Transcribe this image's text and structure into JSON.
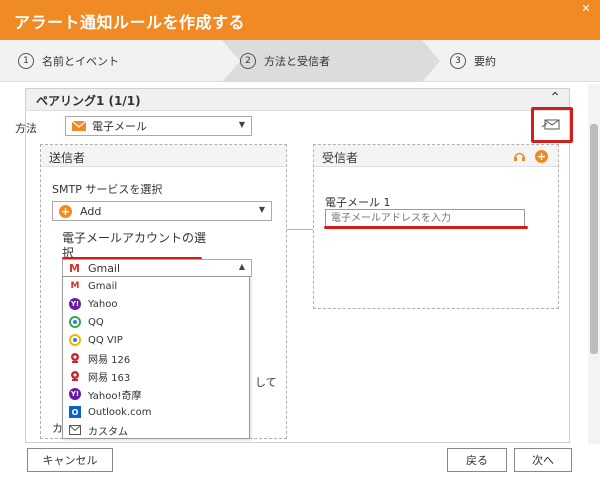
{
  "window": {
    "title": "アラート通知ルールを作成する",
    "close_glyph": "✕"
  },
  "steps": [
    {
      "num": "1",
      "label": "名前とイベント"
    },
    {
      "num": "2",
      "label": "方法と受信者"
    },
    {
      "num": "3",
      "label": "要約"
    }
  ],
  "pairing": {
    "title": "ペアリング1 (1/1)",
    "collapse_glyph": "⌃"
  },
  "method": {
    "label": "方法",
    "value": "電子メール"
  },
  "sender": {
    "title": "送信者",
    "smtp_label": "SMTP サービスを選択",
    "smtp_value": "Add",
    "account_label_line1": "電子メールアカウントの選",
    "account_label_line2": "択",
    "account_value": "Gmail",
    "hidden_text_right": "して",
    "hidden_text_left": "カ"
  },
  "recipient": {
    "title": "受信者",
    "email_label": "電子メール 1",
    "email_placeholder": "電子メールアドレスを入力"
  },
  "dropdown_options": [
    {
      "label": "Gmail",
      "icon": "gmail-icon"
    },
    {
      "label": "Yahoo",
      "icon": "yahoo-icon"
    },
    {
      "label": "QQ",
      "icon": "qq-icon"
    },
    {
      "label": "QQ VIP",
      "icon": "qq-icon"
    },
    {
      "label": "网易 126",
      "icon": "netease-icon"
    },
    {
      "label": "网易 163",
      "icon": "netease-icon"
    },
    {
      "label": "Yahoo!奇摩",
      "icon": "yahoo-icon"
    },
    {
      "label": "Outlook.com",
      "icon": "outlook-icon"
    },
    {
      "label": "カスタム",
      "icon": "envelope-icon"
    }
  ],
  "buttons": {
    "cancel": "キャンセル",
    "back": "戻る",
    "next": "次へ"
  },
  "colors": {
    "accent": "#f08a24",
    "highlight": "#d21d1d"
  }
}
